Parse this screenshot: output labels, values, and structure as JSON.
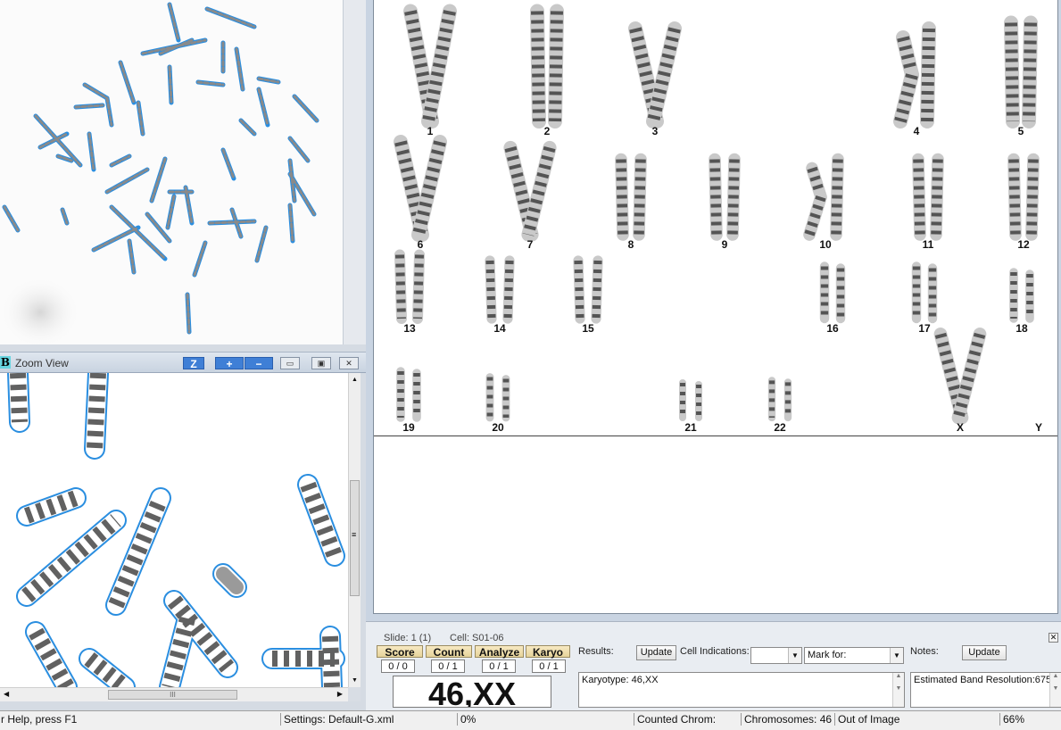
{
  "zoom_view": {
    "title": "Zoom View",
    "title_icon": "B",
    "buttons": {
      "z": "Z",
      "zoom_in": "+",
      "zoom_out": "−"
    },
    "scroll_grip": "III",
    "vscroll_grip": "≡"
  },
  "karyogram": {
    "labels": [
      "1",
      "2",
      "3",
      "4",
      "5",
      "6",
      "7",
      "8",
      "9",
      "10",
      "11",
      "12",
      "13",
      "14",
      "15",
      "16",
      "17",
      "18",
      "19",
      "20",
      "21",
      "22",
      "X",
      "Y"
    ]
  },
  "score_panel": {
    "slide": "Slide: 1 (1)",
    "cell": "Cell: S01-06",
    "tabs": [
      "Score",
      "Count",
      "Analyze",
      "Karyo"
    ],
    "counts": [
      "0 / 0",
      "0 / 1",
      "0 / 1",
      "0 / 1"
    ],
    "result": "46,XX",
    "results_label": "Results:",
    "update_label": "Update",
    "cell_indications_label": "Cell Indications:",
    "cell_indications_value": "",
    "mark_for_label": "Mark for:",
    "notes_label": "Notes:",
    "notes_update_label": "Update",
    "results_text": "Karyotype: 46,XX",
    "notes_text": "Estimated Band Resolution:675"
  },
  "status_bar": {
    "help": "r Help, press F1",
    "settings": "Settings: Default-G.xml",
    "progress": "0%",
    "counted": "Counted Chrom:",
    "chromosomes": "Chromosomes:  46",
    "out_of_image": "Out of Image",
    "zoom": "66%"
  },
  "colors": {
    "outline": "#2a8ee0",
    "zoom_button": "#3f7fd6",
    "tab": "#efdcaa"
  }
}
